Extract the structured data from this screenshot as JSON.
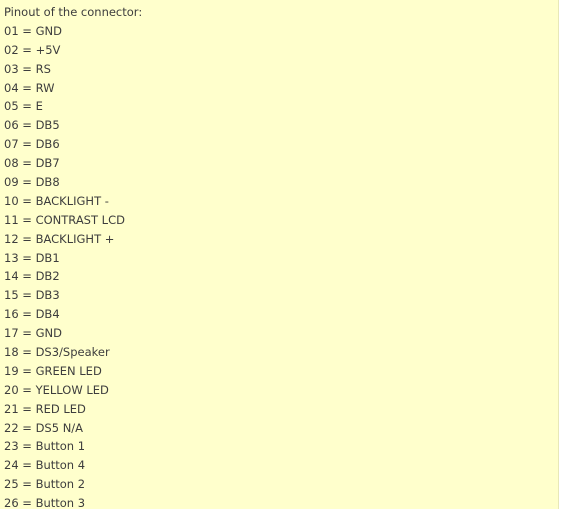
{
  "heading": "Pinout of the connector:",
  "pins": [
    "01 = GND",
    "02 = +5V",
    "03 = RS",
    "04 = RW",
    "05 = E",
    "06 = DB5",
    "07 = DB6",
    "08 = DB7",
    "09 = DB8",
    "10 = BACKLIGHT -",
    "11 = CONTRAST LCD",
    "12 = BACKLIGHT +",
    "13 = DB1",
    "14 = DB2",
    "15 = DB3",
    "16 = DB4",
    "17 = GND",
    "18 = DS3/Speaker",
    "19 = GREEN LED",
    "20 = YELLOW LED",
    "21 = RED LED",
    "22 = DS5 N/A",
    "23 = Button 1",
    "24 = Button 4",
    "25 = Button 2",
    "26 = Button 3"
  ]
}
